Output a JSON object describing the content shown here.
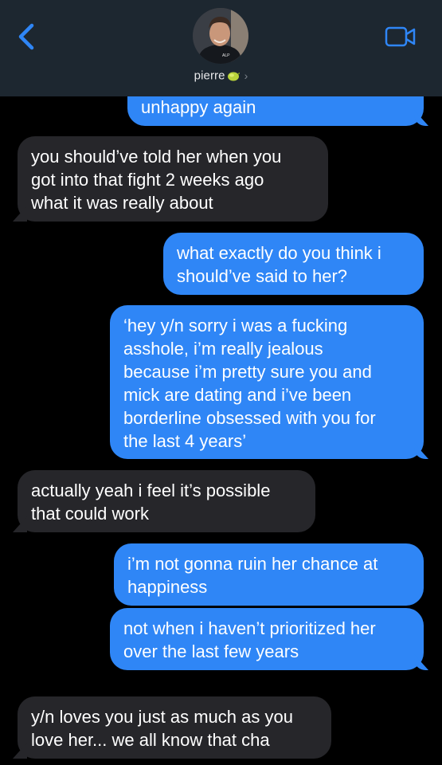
{
  "header": {
    "contact_name": "pierre",
    "contact_emoji_icon": "lime-icon",
    "chevron": "›",
    "back_icon": "chevron-left-icon",
    "video_icon": "video-camera-icon"
  },
  "colors": {
    "header_bg": "#1d2730",
    "sent_bubble": "#2f86f6",
    "received_bubble": "#26262a",
    "accent": "#2f86f6",
    "background": "#000000"
  },
  "messages": [
    {
      "direction": "sent",
      "text": "unhappy again"
    },
    {
      "direction": "received",
      "lines": [
        "you should’ve told her when you",
        "got into that fight 2 weeks ago",
        "what it was really about"
      ]
    },
    {
      "direction": "sent",
      "lines": [
        "what exactly do you think i",
        "should’ve said to her?"
      ]
    },
    {
      "direction": "sent",
      "lines": [
        "‘hey y/n sorry i was a fucking",
        "asshole, i’m really jealous",
        "because i’m pretty sure you and",
        "mick are dating and i’ve been",
        "borderline obsessed with you for",
        "the last 4 years’"
      ]
    },
    {
      "direction": "received",
      "lines": [
        "actually yeah i feel it’s possible",
        "that could work"
      ]
    },
    {
      "direction": "sent",
      "lines": [
        "i’m not gonna ruin her chance at",
        "happiness"
      ]
    },
    {
      "direction": "sent",
      "lines": [
        "not when i haven’t prioritized her",
        "over the last few years"
      ]
    },
    {
      "direction": "received",
      "lines": [
        "y/n loves you just as much as you",
        "love her... we all know that cha"
      ]
    }
  ]
}
